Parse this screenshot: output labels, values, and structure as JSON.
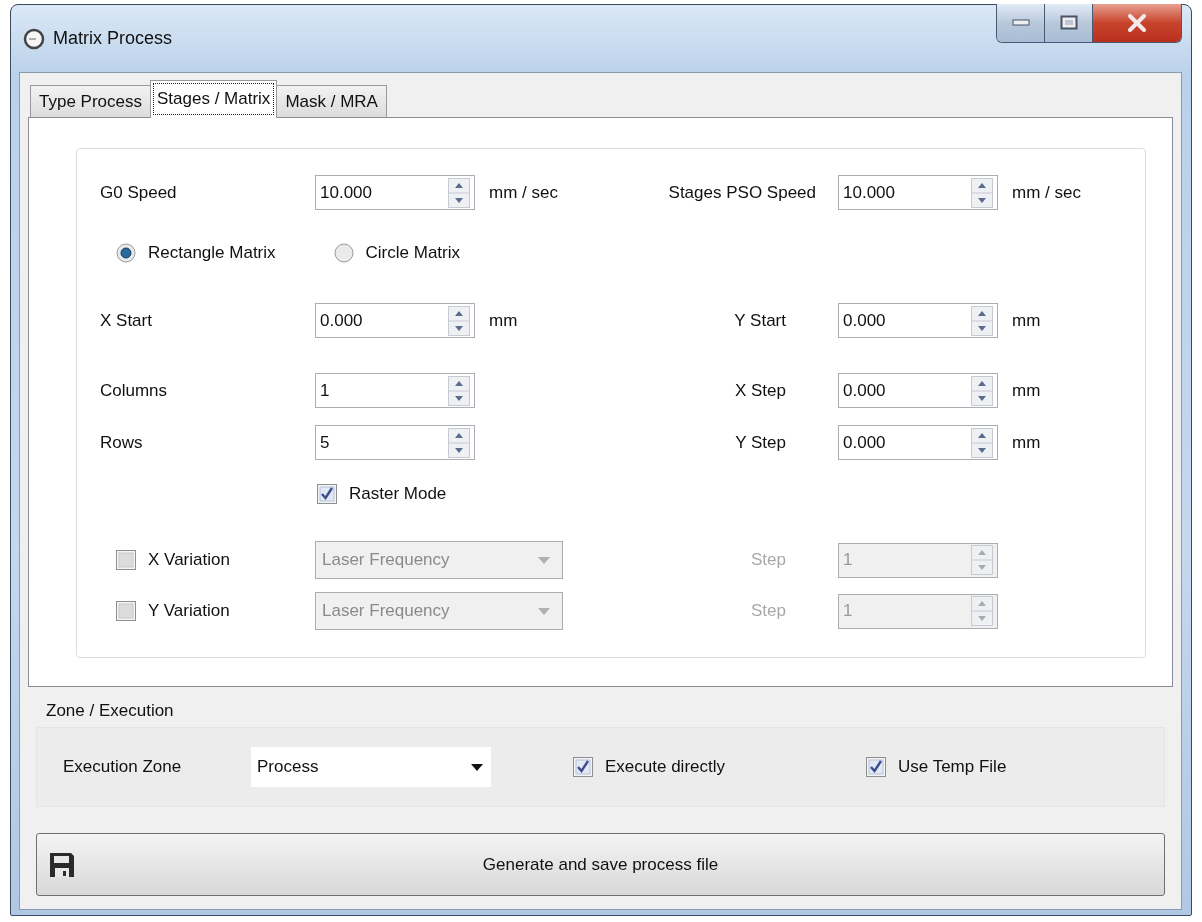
{
  "window": {
    "title": "Matrix Process"
  },
  "tabs": [
    {
      "label": "Type Process",
      "selected": false
    },
    {
      "label": "Stages / Matrix",
      "selected": true
    },
    {
      "label": "Mask / MRA",
      "selected": false
    }
  ],
  "speeds": [
    {
      "label": "G0 Speed",
      "value": "10.000",
      "unit": "mm / sec"
    },
    {
      "label": "Stages PSO Speed",
      "value": "10.000",
      "unit": "mm / sec"
    }
  ],
  "matrix_types": [
    {
      "label": "Rectangle Matrix",
      "selected": true
    },
    {
      "label": "Circle Matrix",
      "selected": false
    }
  ],
  "grid_rows": [
    {
      "left": {
        "label": "X Start",
        "value": "0.000",
        "unit": "mm"
      },
      "right": {
        "label": "Y Start",
        "value": "0.000",
        "unit": "mm"
      }
    },
    {
      "left": {
        "label": "Columns",
        "value": "1"
      },
      "right": {
        "label": "X Step",
        "value": "0.000",
        "unit": "mm"
      }
    },
    {
      "left": {
        "label": "Rows",
        "value": "5"
      },
      "right": {
        "label": "Y Step",
        "value": "0.000",
        "unit": "mm"
      }
    }
  ],
  "raster_mode": {
    "label": "Raster Mode",
    "checked": true
  },
  "variations": [
    {
      "label": "X Variation",
      "checked": false,
      "dropdown": "Laser Frequency",
      "step_label": "Step",
      "step_value": "1"
    },
    {
      "label": "Y Variation",
      "checked": false,
      "dropdown": "Laser Frequency",
      "step_label": "Step",
      "step_value": "1"
    }
  ],
  "zone": {
    "title": "Zone / Execution",
    "execution_zone": {
      "label": "Execution Zone",
      "value": "Process"
    },
    "options": [
      {
        "label": "Execute directly",
        "checked": true
      },
      {
        "label": "Use Temp File",
        "checked": true
      }
    ]
  },
  "generate_button": {
    "label": "Generate and save process file"
  }
}
